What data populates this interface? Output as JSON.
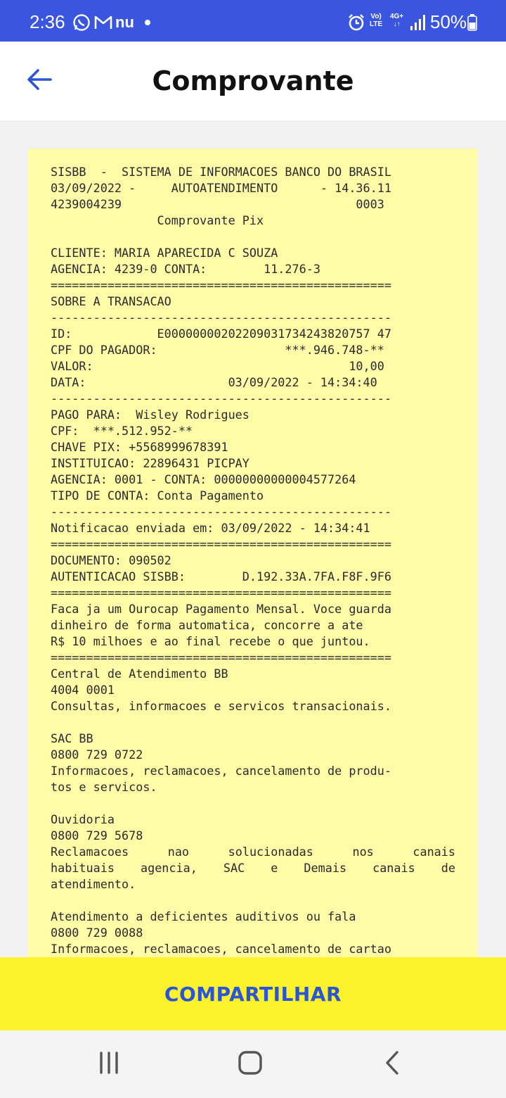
{
  "status_bar": {
    "time": "2:36",
    "battery_percent": "50%",
    "icons": [
      "whatsapp-icon",
      "gmail-icon",
      "nubank-icon",
      "dot-icon",
      "alarm-icon",
      "volte-icon",
      "4g-icon",
      "signal-icon",
      "battery-icon"
    ],
    "nu_label": "nu",
    "volte_top": "Vo)",
    "volte_bottom": "LTE",
    "net_label": "4G+",
    "color": "#3a56e0"
  },
  "app_bar": {
    "title": "Comprovante",
    "back_icon": "arrow-left-icon",
    "back_color": "#2a55d6"
  },
  "receipt": {
    "background": "#fffca7",
    "lines": [
      "SISBB  -  SISTEMA DE INFORMACOES BANCO DO BRASIL",
      "03/09/2022 -     AUTOATENDIMENTO      - 14.36.11",
      "4239004239                                 0003",
      "               Comprovante Pix",
      "",
      "CLIENTE: MARIA APARECIDA C SOUZA",
      "AGENCIA: 4239-0 CONTA:        11.276-3",
      "================================================",
      "SOBRE A TRANSACAO",
      "------------------------------------------------",
      "ID:            E00000000202209031734243820757 47",
      "CPF DO PAGADOR:                  ***.946.748-**",
      "VALOR:                                    10,00",
      "DATA:                    03/09/2022 - 14:34:40",
      "------------------------------------------------",
      "PAGO PARA:  Wisley Rodrigues",
      "CPF:  ***.512.952-**",
      "CHAVE PIX: +5568999678391",
      "INSTITUICAO: 22896431 PICPAY",
      "AGENCIA: 0001 - CONTA: 00000000000004577264",
      "TIPO DE CONTA: Conta Pagamento",
      "------------------------------------------------",
      "Notificacao enviada em: 03/09/2022 - 14:34:41",
      "================================================",
      "DOCUMENTO: 090502",
      "AUTENTICACAO SISBB:        D.192.33A.7FA.F8F.9F6",
      "================================================",
      "Faca ja um Ourocap Pagamento Mensal. Voce guarda",
      "dinheiro de forma automatica, concorre a ate",
      "R$ 10 milhoes e ao final recebe o que juntou.",
      "================================================",
      "Central de Atendimento BB",
      "4004 0001",
      "Consultas, informacoes e servicos transacionais.",
      "",
      "SAC BB",
      "0800 729 0722",
      "Informacoes, reclamacoes, cancelamento de produ-",
      "tos e servicos.",
      "",
      "Ouvidoria",
      "0800 729 5678",
      "Reclamacoes    nao    solucionadas    nos   canais",
      "habituais  agencia,  SAC  e  Demais  canais  de",
      "atendimento.",
      "",
      "Atendimento a deficientes auditivos ou fala",
      "0800 729 0088",
      "Informacoes, reclamacoes, cancelamento de cartao"
    ]
  },
  "share_button": {
    "label": "COMPARTILHAR",
    "background": "#fcf22c",
    "text_color": "#2a55d6"
  },
  "nav_bar": {
    "icons": [
      "recent-apps-icon",
      "home-icon",
      "back-icon"
    ]
  }
}
